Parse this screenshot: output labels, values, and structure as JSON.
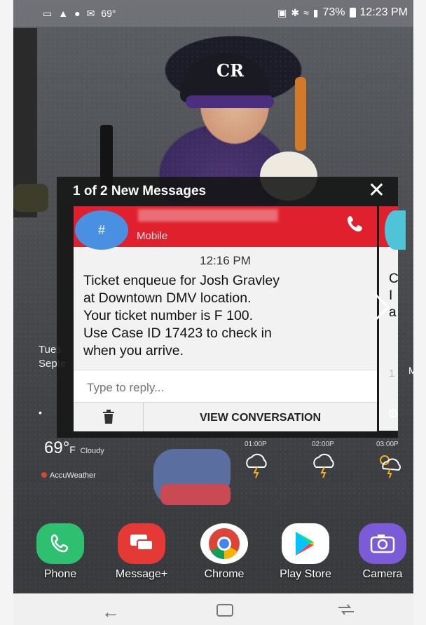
{
  "status_bar": {
    "temp": "69°",
    "battery": "73%",
    "time": "12:23 PM"
  },
  "popup": {
    "title": "1 of 2 New Messages",
    "close_icon": "close-icon",
    "sender_type": "Mobile",
    "avatar_symbol": "#",
    "time": "12:16 PM",
    "message_lines": [
      "Ticket enqueue for Josh Gravley",
      "at Downtown DMV location.",
      "Your ticket number is  F 100.",
      "Use Case ID  17423 to check in",
      "when you arrive."
    ],
    "reply_placeholder": "Type to reply...",
    "view_conversation": "VIEW CONVERSATION",
    "next_card_lines": [
      "C",
      "I",
      "a"
    ],
    "next_card_time": "1"
  },
  "weather": {
    "date_line1": "Tues",
    "date_line2": "Septe",
    "right_fragment": "M",
    "temperature": "69°",
    "temp_unit": "F",
    "condition": "Cloudy",
    "provider": "AccuWeather",
    "forecast_labels": [
      "01:00P",
      "02:00P",
      "03:00P"
    ]
  },
  "dock": {
    "apps": [
      {
        "label": "Phone",
        "color": "#2fbf71"
      },
      {
        "label": "Message+",
        "color": "#e53935"
      },
      {
        "label": "Chrome",
        "color": "#ffffff"
      },
      {
        "label": "Play Store",
        "color": "#ffffff"
      },
      {
        "label": "Camera",
        "color": "#7b5bd6"
      }
    ]
  },
  "colors": {
    "header_red": "#e0202d",
    "avatar_blue": "#4a90e2"
  }
}
